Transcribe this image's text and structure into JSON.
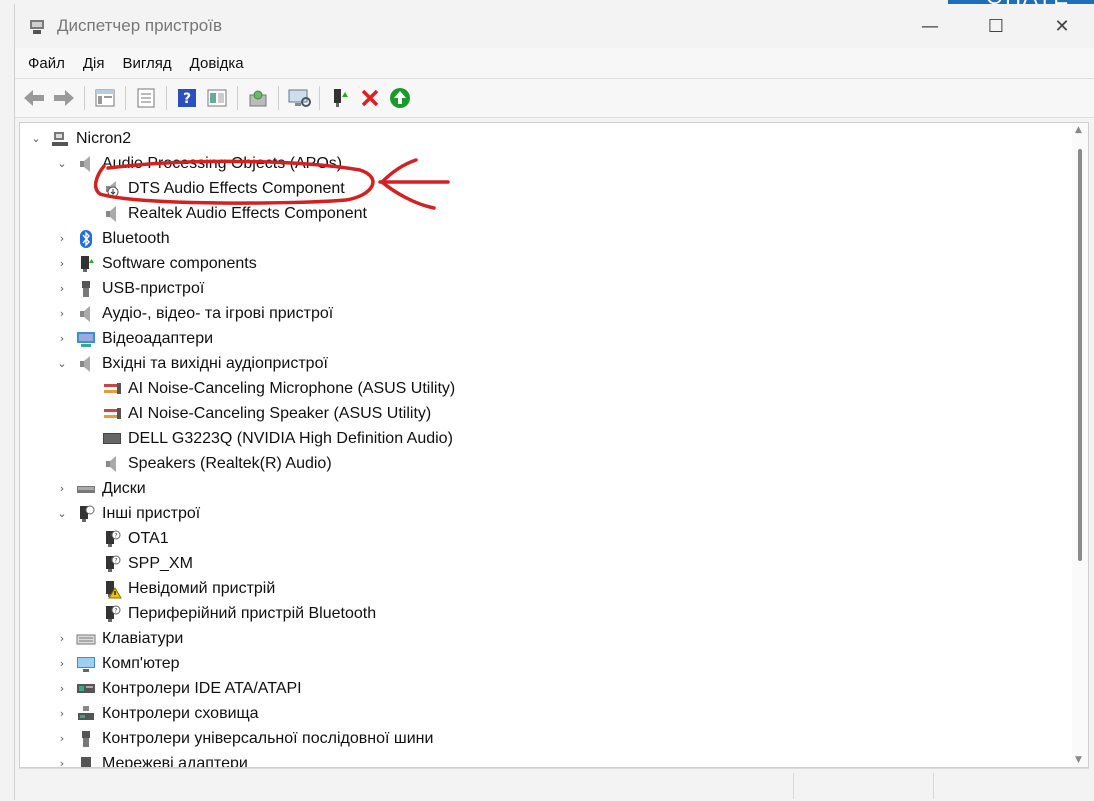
{
  "window": {
    "title": "Диспетчер пристроїв",
    "controls": {
      "minimize": "—",
      "maximize": "☐",
      "close": "✕"
    },
    "corner_text": "ОНАТЕ"
  },
  "menu": {
    "items": [
      "Файл",
      "Дія",
      "Вигляд",
      "Довідка"
    ]
  },
  "toolbar": {
    "buttons": [
      "back-arrow-icon",
      "forward-arrow-icon",
      "properties-icon",
      "device-list-icon",
      "help-icon",
      "view-icon",
      "update-driver-icon",
      "scan-hardware-icon",
      "enable-device-icon",
      "uninstall-icon",
      "install-icon"
    ]
  },
  "tree": {
    "computer": "Nicron2",
    "apo": {
      "label": "Audio Processing Objects (APOs)",
      "children": [
        "DTS Audio Effects Component",
        "Realtek Audio Effects Component"
      ]
    },
    "bluetooth": "Bluetooth",
    "software_components": "Software components",
    "usb": "USB-пристрої",
    "audio_video_game": "Аудіо-, відео- та ігрові пристрої",
    "video_adapters": "Відеоадаптери",
    "audio_io": {
      "label": "Вхідні та вихідні аудіопристрої",
      "children": [
        "AI Noise-Canceling Microphone (ASUS Utility)",
        "AI Noise-Canceling Speaker (ASUS Utility)",
        "DELL G3223Q (NVIDIA High Definition Audio)",
        "Speakers (Realtek(R) Audio)"
      ]
    },
    "disks": "Диски",
    "other": {
      "label": "Інші пристрої",
      "children": [
        "OTA1",
        "SPP_XM",
        "Невідомий пристрій",
        "Периферійний пристрій Bluetooth"
      ]
    },
    "keyboards": "Клавіатури",
    "computer_cat": "Комп'ютер",
    "ide": "Контролери IDE ATA/ATAPI",
    "storage": "Контролери сховища",
    "usb_controllers": "Контролери універсальної послідовної шини",
    "network": "Мережеві адаптери"
  },
  "colors": {
    "annotation": "#d42020",
    "accent": "#1e6fb8"
  }
}
